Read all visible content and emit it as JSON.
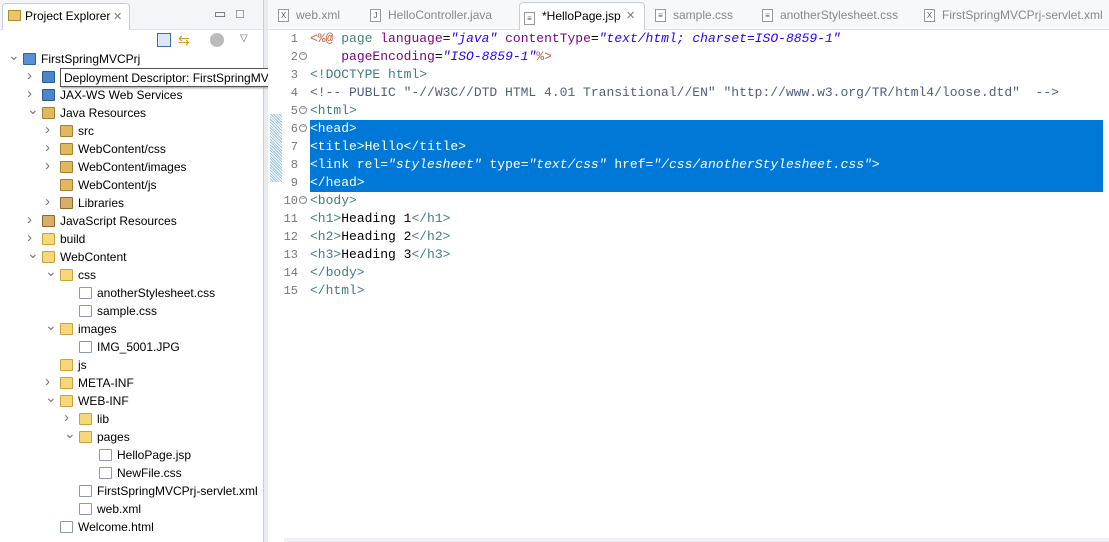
{
  "explorer": {
    "title": "Project Explorer",
    "tree": [
      {
        "label": "FirstSpringMVCPrj",
        "level": 0,
        "state": "open",
        "icon": "project"
      },
      {
        "label": "Deployment Descriptor: FirstSpringMVCPrj",
        "level": 1,
        "state": "closed",
        "icon": "web",
        "tooltip": true
      },
      {
        "label": "JAX-WS Web Services",
        "level": 1,
        "state": "closed",
        "icon": "web"
      },
      {
        "label": "Java Resources",
        "level": 1,
        "state": "open",
        "icon": "pkg"
      },
      {
        "label": "src",
        "level": 2,
        "state": "closed",
        "icon": "pkg"
      },
      {
        "label": "WebContent/css",
        "level": 2,
        "state": "closed",
        "icon": "pkg"
      },
      {
        "label": "WebContent/images",
        "level": 2,
        "state": "closed",
        "icon": "pkg"
      },
      {
        "label": "WebContent/js",
        "level": 2,
        "state": "leaf",
        "icon": "pkg"
      },
      {
        "label": "Libraries",
        "level": 2,
        "state": "closed",
        "icon": "lib"
      },
      {
        "label": "JavaScript Resources",
        "level": 1,
        "state": "closed",
        "icon": "lib"
      },
      {
        "label": "build",
        "level": 1,
        "state": "closed",
        "icon": "folder"
      },
      {
        "label": "WebContent",
        "level": 1,
        "state": "open",
        "icon": "folder"
      },
      {
        "label": "css",
        "level": 2,
        "state": "open",
        "icon": "folder"
      },
      {
        "label": "anotherStylesheet.css",
        "level": 3,
        "state": "leaf",
        "icon": "file"
      },
      {
        "label": "sample.css",
        "level": 3,
        "state": "leaf",
        "icon": "file"
      },
      {
        "label": "images",
        "level": 2,
        "state": "open",
        "icon": "folder"
      },
      {
        "label": "IMG_5001.JPG",
        "level": 3,
        "state": "leaf",
        "icon": "file"
      },
      {
        "label": "js",
        "level": 2,
        "state": "leaf",
        "icon": "folder"
      },
      {
        "label": "META-INF",
        "level": 2,
        "state": "closed",
        "icon": "folder"
      },
      {
        "label": "WEB-INF",
        "level": 2,
        "state": "open",
        "icon": "folder"
      },
      {
        "label": "lib",
        "level": 3,
        "state": "closed",
        "icon": "folder"
      },
      {
        "label": "pages",
        "level": 3,
        "state": "open",
        "icon": "folder"
      },
      {
        "label": "HelloPage.jsp",
        "level": 4,
        "state": "leaf",
        "icon": "file"
      },
      {
        "label": "NewFile.css",
        "level": 4,
        "state": "leaf",
        "icon": "file"
      },
      {
        "label": "FirstSpringMVCPrj-servlet.xml",
        "level": 3,
        "state": "leaf",
        "icon": "file"
      },
      {
        "label": "web.xml",
        "level": 3,
        "state": "leaf",
        "icon": "file"
      },
      {
        "label": "Welcome.html",
        "level": 2,
        "state": "leaf",
        "icon": "file"
      }
    ]
  },
  "editor": {
    "tabs": [
      {
        "label": "web.xml",
        "glyph": "X",
        "active": false
      },
      {
        "label": "HelloController.java",
        "glyph": "J",
        "active": false
      },
      {
        "label": "*HelloPage.jsp",
        "glyph": "≡",
        "active": true
      },
      {
        "label": "sample.css",
        "glyph": "≡",
        "active": false
      },
      {
        "label": "anotherStylesheet.css",
        "glyph": "≡",
        "active": false
      },
      {
        "label": "FirstSpringMVCPrj-servlet.xml",
        "glyph": "X",
        "active": false
      }
    ],
    "lines": [
      {
        "n": "1",
        "tokens": [
          [
            "<%@ ",
            "jsp"
          ],
          [
            "page ",
            "tag"
          ],
          [
            "language",
            "attr"
          ],
          [
            "=",
            "txt"
          ],
          [
            "\"java\"",
            "str"
          ],
          [
            " ",
            "txt"
          ],
          [
            "contentType",
            "attr"
          ],
          [
            "=",
            "txt"
          ],
          [
            "\"text/html; charset=ISO-8859-1\"",
            "str"
          ]
        ]
      },
      {
        "n": "2",
        "fold": true,
        "tokens": [
          [
            "    ",
            "txt"
          ],
          [
            "pageEncoding",
            "attr"
          ],
          [
            "=",
            "txt"
          ],
          [
            "\"ISO-8859-1\"",
            "str"
          ],
          [
            "%>",
            "jsp"
          ]
        ]
      },
      {
        "n": "3",
        "tokens": [
          [
            "<!DOCTYPE html>",
            "tag"
          ]
        ]
      },
      {
        "n": "4",
        "tokens": [
          [
            "<!-- PUBLIC \"-//W3C//DTD HTML 4.01 Transitional//EN\" \"http://www.w3.org/TR/html4/loose.dtd\"  -->",
            "com"
          ]
        ]
      },
      {
        "n": "5",
        "fold": true,
        "tokens": [
          [
            "<html>",
            "tag"
          ]
        ]
      },
      {
        "n": "6",
        "fold": true,
        "sel": true,
        "tokens": [
          [
            "<head>",
            "tag"
          ]
        ]
      },
      {
        "n": "7",
        "sel": true,
        "tokens": [
          [
            "<title>",
            "tag"
          ],
          [
            "Hello",
            "txt"
          ],
          [
            "</title>",
            "tag"
          ]
        ]
      },
      {
        "n": "8",
        "sel": true,
        "tokens": [
          [
            "<link ",
            "tag"
          ],
          [
            "rel",
            "attr"
          ],
          [
            "=",
            "txt"
          ],
          [
            "\"stylesheet\"",
            "str"
          ],
          [
            " ",
            "txt"
          ],
          [
            "type",
            "attr"
          ],
          [
            "=",
            "txt"
          ],
          [
            "\"text/css\"",
            "str"
          ],
          [
            " ",
            "txt"
          ],
          [
            "href",
            "attr"
          ],
          [
            "=",
            "txt"
          ],
          [
            "\"/css/anotherStylesheet.css\"",
            "str"
          ],
          [
            ">",
            "tag"
          ]
        ]
      },
      {
        "n": "9",
        "sel": true,
        "tokens": [
          [
            "</head>",
            "tag"
          ]
        ]
      },
      {
        "n": "10",
        "fold": true,
        "tokens": [
          [
            "<body>",
            "tag"
          ]
        ]
      },
      {
        "n": "11",
        "tokens": [
          [
            "<h1>",
            "tag"
          ],
          [
            "Heading 1",
            "txt"
          ],
          [
            "</h1>",
            "tag"
          ]
        ]
      },
      {
        "n": "12",
        "tokens": [
          [
            "<h2>",
            "tag"
          ],
          [
            "Heading 2",
            "txt"
          ],
          [
            "</h2>",
            "tag"
          ]
        ]
      },
      {
        "n": "13",
        "tokens": [
          [
            "<h3>",
            "tag"
          ],
          [
            "Heading 3",
            "txt"
          ],
          [
            "</h3>",
            "tag"
          ]
        ]
      },
      {
        "n": "14",
        "tokens": [
          [
            "</body>",
            "tag"
          ]
        ]
      },
      {
        "n": "15",
        "tokens": [
          [
            "</html>",
            "tag"
          ]
        ]
      }
    ]
  }
}
